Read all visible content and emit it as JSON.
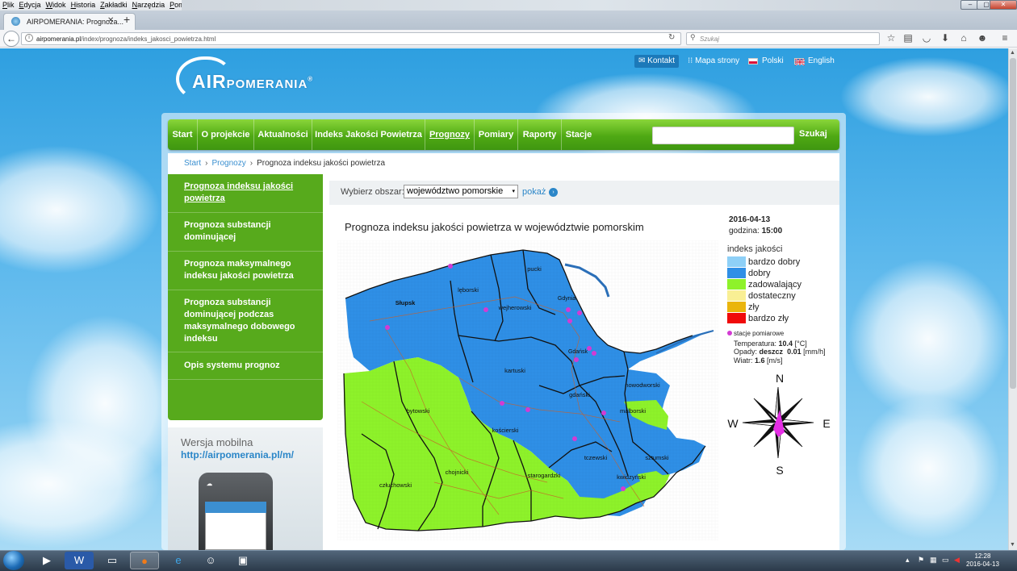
{
  "browser": {
    "menu": [
      "Plik",
      "Edycja",
      "Widok",
      "Historia",
      "Zakładki",
      "Narzędzia",
      "Pomoc"
    ],
    "tab_title": "AIRPOMERANIA: Prognoza...",
    "url_domain": "airpomerania.pl",
    "url_path": "/index/prognoza/indeks_jakosci_powietrza.html",
    "search_placeholder": "Szukaj"
  },
  "site": {
    "logo_air": "AIR",
    "logo_pomerania": "POMERANIA",
    "logo_reg": "®",
    "top_links": {
      "kontakt": "Kontakt",
      "mapa": "Mapa strony",
      "polski": "Polski",
      "english": "English"
    },
    "nav": [
      "Start",
      "O projekcie",
      "Aktualności",
      "Indeks Jakości Powietrza",
      "Prognozy",
      "Pomiary",
      "Raporty",
      "Stacje"
    ],
    "nav_active": "Prognozy",
    "search_button": "Szukaj",
    "breadcrumb": [
      "Start",
      "Prognozy",
      "Prognoza indeksu jakości powietrza"
    ],
    "sidebar": [
      "Prognoza indeksu jakości powietrza",
      "Prognoza substancji dominującej",
      "Prognoza maksymalnego indeksu jakości powietrza",
      "Prognoza substancji dominującej podczas maksymalnego dobowego indeksu",
      "Opis systemu prognoz"
    ],
    "mobile": {
      "title": "Wersja mobilna",
      "link": "http://airpomerania.pl/m/"
    }
  },
  "content": {
    "area_label": "Wybierz obszar:",
    "area_value": "województwo pomorskie",
    "pokaz": "pokaż",
    "map_title": "Prognoza indeksu jakości powietrza w województwie pomorskim",
    "date": "2016-04-13",
    "hour_label": "godzina:",
    "hour": "15:00",
    "legend_title": "indeks jakości",
    "legend": [
      {
        "label": "bardzo dobry",
        "color": "#8ed0f7"
      },
      {
        "label": "dobry",
        "color": "#2f8fe6"
      },
      {
        "label": "zadowalający",
        "color": "#8ef22a"
      },
      {
        "label": "dostateczny",
        "color": "#f9ef94"
      },
      {
        "label": "zły",
        "color": "#eab50c"
      },
      {
        "label": "bardzo zły",
        "color": "#f00a0a"
      }
    ],
    "stations_label": "stacje pomiarowe",
    "temp_label": "Temperatura:",
    "temp_value": "10.4",
    "temp_unit": "[°C]",
    "rain_label": "Opady:",
    "rain_type": "deszcz",
    "rain_value": "0.01",
    "rain_unit": "[mm/h]",
    "wind_label": "Wiatr:",
    "wind_value": "1.6",
    "wind_unit": "[m/s]",
    "compass": {
      "n": "N",
      "e": "E",
      "s": "S",
      "w": "W"
    },
    "districts": [
      "pucki",
      "wejherowski",
      "Słupsk",
      "lęborski",
      "kartuski",
      "gdański",
      "nowodworski",
      "bytowski",
      "kościerski",
      "malborski",
      "chojnicki",
      "starogardzki",
      "tczewski",
      "sztumski",
      "człuchowski",
      "kwidzyński",
      "Gdynia",
      "Gdańsk"
    ]
  },
  "taskbar": {
    "time": "12:28",
    "date": "2016-04-13"
  }
}
